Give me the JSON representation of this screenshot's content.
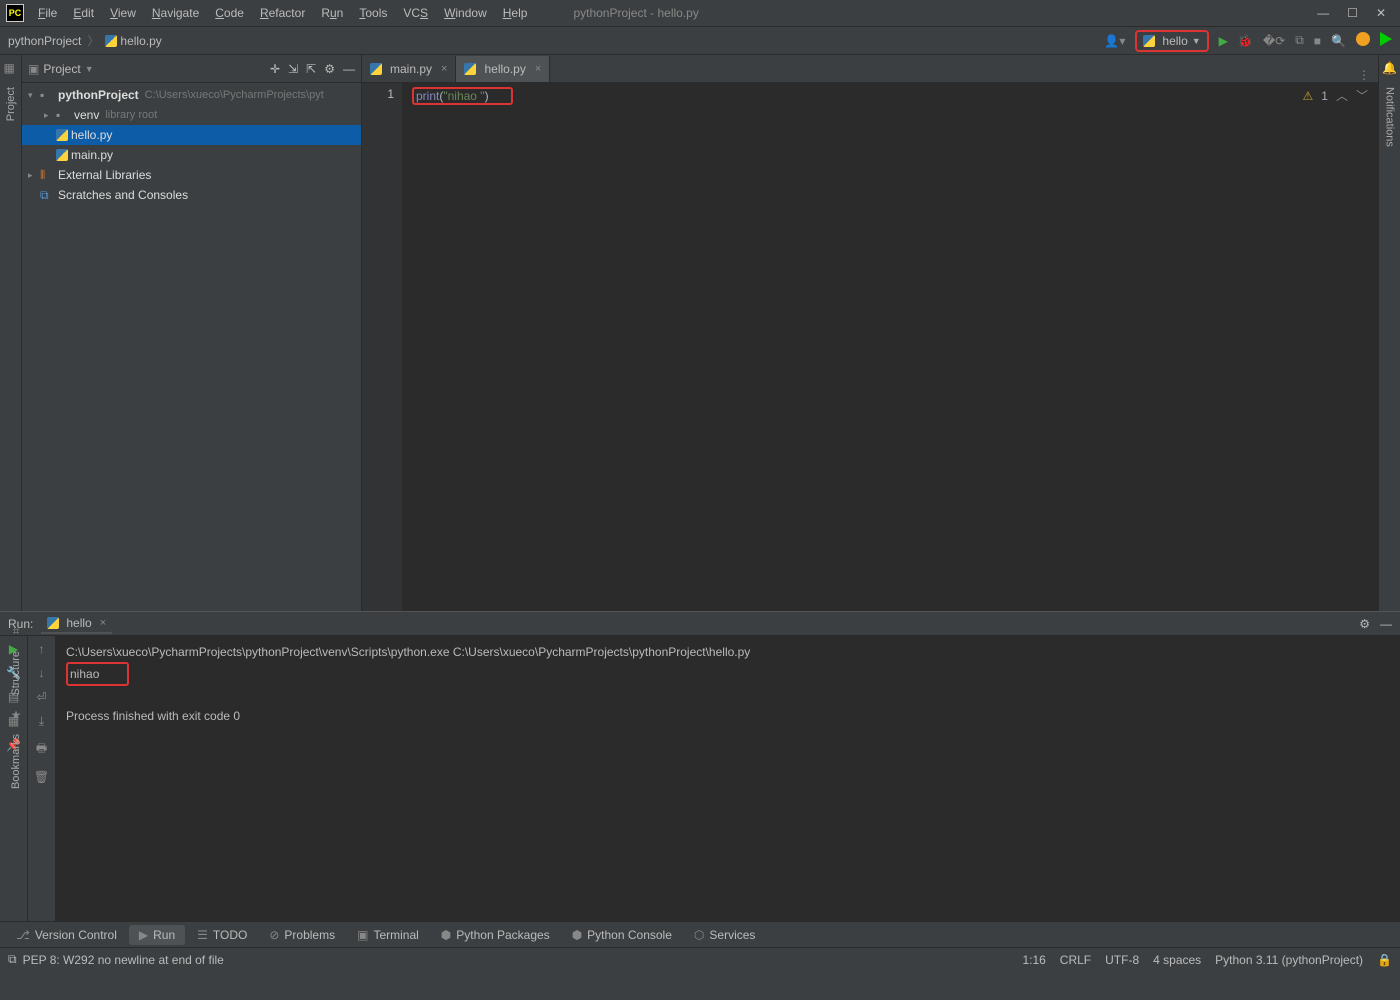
{
  "window": {
    "title": "pythonProject - hello.py"
  },
  "menu": [
    "File",
    "Edit",
    "View",
    "Navigate",
    "Code",
    "Refactor",
    "Run",
    "Tools",
    "VCS",
    "Window",
    "Help"
  ],
  "breadcrumb": {
    "project": "pythonProject",
    "file": "hello.py"
  },
  "runconfig": {
    "name": "hello"
  },
  "project_tool": {
    "title": "Project",
    "root": "pythonProject",
    "root_path": "C:\\Users\\xueco\\PycharmProjects\\pyt",
    "venv": "venv",
    "venv_hint": "library root",
    "files": [
      "hello.py",
      "main.py"
    ],
    "external": "External Libraries",
    "scratches": "Scratches and Consoles"
  },
  "tabs": [
    {
      "label": "main.py",
      "active": false
    },
    {
      "label": "hello.py",
      "active": true
    }
  ],
  "editor": {
    "line_no": "1",
    "code_fn": "print",
    "code_open": "(",
    "code_str": "\"nihao \"",
    "code_close": ")",
    "warn_count": "1"
  },
  "run": {
    "title": "Run:",
    "config": "hello",
    "cmd": "C:\\Users\\xueco\\PycharmProjects\\pythonProject\\venv\\Scripts\\python.exe C:\\Users\\xueco\\PycharmProjects\\pythonProject\\hello.py",
    "out": "nihao",
    "exitline": "Process finished with exit code 0"
  },
  "leftrail": {
    "project": "Project"
  },
  "rightrail": {
    "notifications": "Notifications"
  },
  "lowerrails": {
    "structure": "Structure",
    "bookmarks": "Bookmarks"
  },
  "bottom": {
    "vcs": "Version Control",
    "run": "Run",
    "todo": "TODO",
    "problems": "Problems",
    "terminal": "Terminal",
    "pypkg": "Python Packages",
    "pyconsole": "Python Console",
    "services": "Services"
  },
  "status": {
    "msg": "PEP 8: W292 no newline at end of file",
    "pos": "1:16",
    "crlf": "CRLF",
    "enc": "UTF-8",
    "indent": "4 spaces",
    "interp": "Python 3.11 (pythonProject)"
  }
}
